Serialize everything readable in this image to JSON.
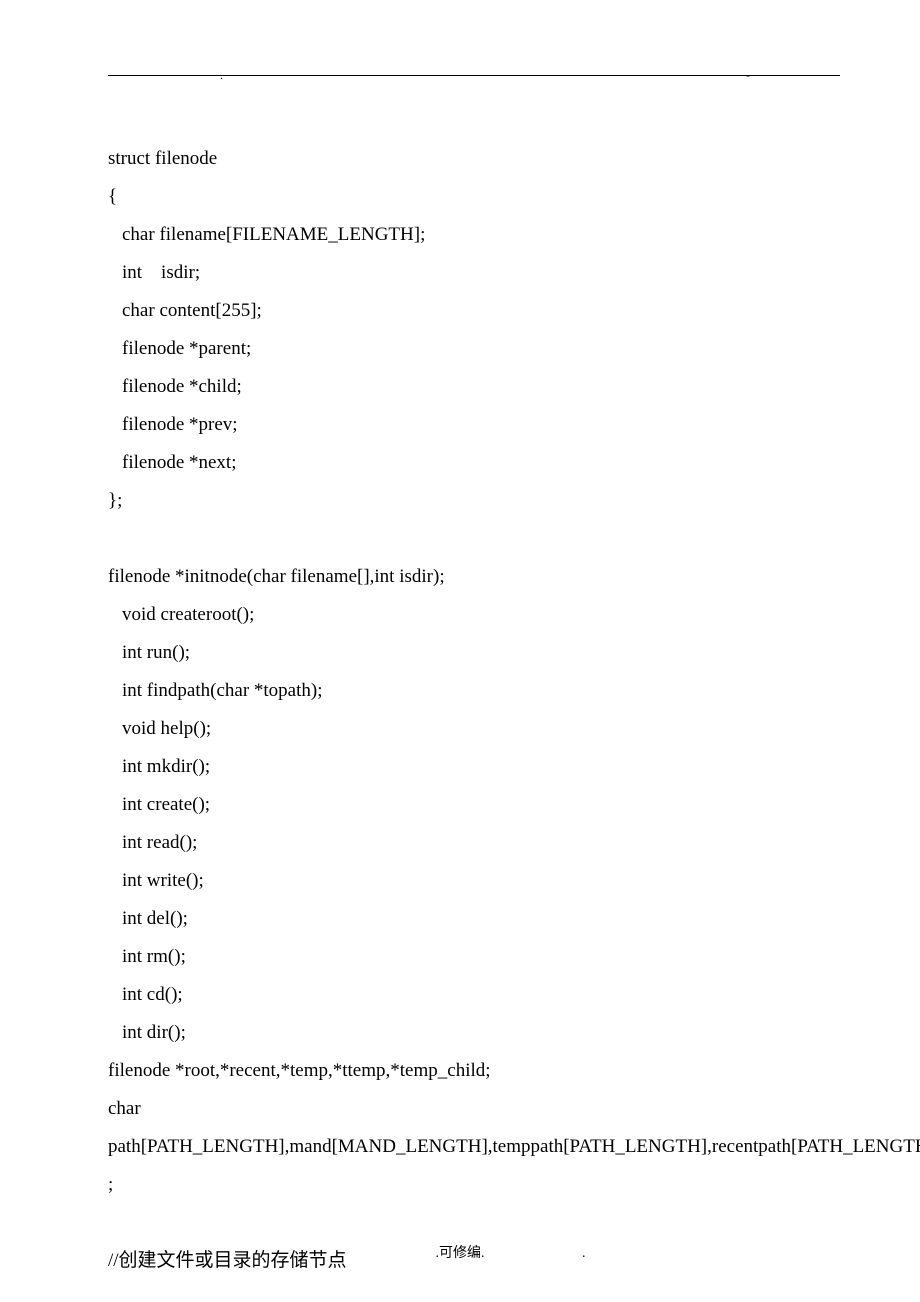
{
  "header": {
    "dot_left": ".",
    "dash_right": "-"
  },
  "code": {
    "line1": "struct filenode",
    "line2": "{",
    "line3": "char filename[FILENAME_LENGTH];",
    "line4": "int    isdir;",
    "line5": "char content[255];",
    "line6": "filenode *parent;",
    "line7": "filenode *child;",
    "line8": "filenode *prev;",
    "line9": "filenode *next;",
    "line10": "};",
    "line11": "filenode *initnode(char filename[],int isdir);",
    "line12": "void createroot();",
    "line13": "int run();",
    "line14": "int findpath(char *topath);",
    "line15": "void help();",
    "line16": "int mkdir();",
    "line17": "int create();",
    "line18": "int read();",
    "line19": "int write();",
    "line20": "int del();",
    "line21": "int rm();",
    "line22": "int cd();",
    "line23": "int dir();",
    "line24": "filenode *root,*recent,*temp,*ttemp,*temp_child;",
    "line25": "char",
    "line26": "path[PATH_LENGTH],mand[MAND_LENGTH],temppath[PATH_LENGTH],recentpath[PATH_LENGTH]",
    "line27": ";",
    "line28": "//创建文件或目录的存储节点"
  },
  "footer": {
    "dot1": ".",
    "text": ".可修编.",
    "dot2": "."
  }
}
